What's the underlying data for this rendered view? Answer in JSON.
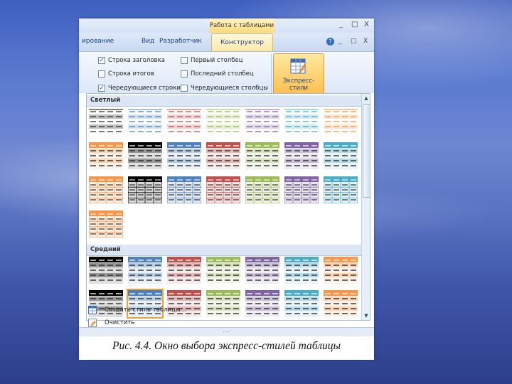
{
  "window": {
    "context_tab_title": "Работа с таблицами",
    "controls": [
      "_",
      "□",
      "X"
    ],
    "ribbon_controls": [
      "_",
      "□",
      "X"
    ]
  },
  "tabs": [
    {
      "label": "ирование",
      "active": false
    },
    {
      "label": "Вид",
      "active": false
    },
    {
      "label": "Разработчик",
      "active": false
    },
    {
      "label": "Конструктор",
      "active": true
    }
  ],
  "help_icon": "?",
  "options": [
    {
      "label": "Строка заголовка",
      "checked": true
    },
    {
      "label": "Строка итогов",
      "checked": false
    },
    {
      "label": "Чередующиеся строки",
      "checked": true
    },
    {
      "label": "Первый столбец",
      "checked": false
    },
    {
      "label": "Последний столбец",
      "checked": false
    },
    {
      "label": "Чередующиеся столбцы",
      "checked": false
    }
  ],
  "express_button": {
    "label": "Экспресс-стили",
    "arrow": "▾"
  },
  "gallery": {
    "groups": [
      {
        "title": "Светлый"
      },
      {
        "title": "Средний"
      }
    ],
    "colors": {
      "black": "#000000",
      "blue": "#4f81bd",
      "red": "#c0504d",
      "green": "#9bbb59",
      "purple": "#8064a2",
      "aqua": "#4bacc6",
      "orange": "#f79646"
    },
    "scroll": {
      "up": "▲",
      "down": "▼"
    }
  },
  "menu": [
    {
      "label": "Создать стиль таблицы...",
      "icon": "new-table-style-icon"
    },
    {
      "label": "Очистить",
      "icon": "clear-icon"
    }
  ],
  "grip": "....",
  "caption": "Рис. 4.4. Окно выбора экспресс-стилей таблицы"
}
